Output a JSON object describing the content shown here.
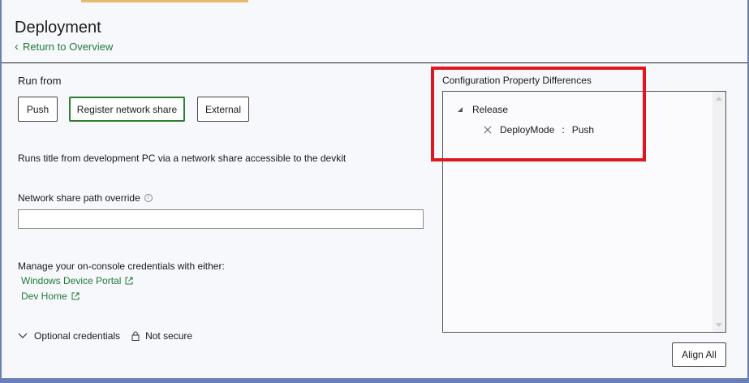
{
  "header": {
    "title": "Deployment",
    "back_link": "Return to Overview"
  },
  "run_from": {
    "label": "Run from",
    "options": [
      {
        "label": "Push"
      },
      {
        "label": "Register network share",
        "selected": true
      },
      {
        "label": "External"
      }
    ],
    "description": "Runs title from development PC via a network share accessible to the devkit"
  },
  "network_share": {
    "label": "Network share path override",
    "info_icon": "info-icon",
    "value": ""
  },
  "credentials": {
    "text": "Manage your on-console credentials with either:",
    "links": [
      {
        "label": "Windows Device Portal",
        "icon": "external-link-icon"
      },
      {
        "label": "Dev Home",
        "icon": "external-link-icon"
      }
    ]
  },
  "optional": {
    "label": "Optional credentials",
    "security_label": "Not secure",
    "icon": "lock-icon"
  },
  "config_diff": {
    "title": "Configuration Property Differences",
    "group": "Release",
    "item": {
      "key": "DeployMode",
      "separator": ":",
      "value": "Push"
    }
  },
  "actions": {
    "align_all": "Align All"
  },
  "colors": {
    "link_green": "#1f7a37",
    "selected_border": "#2e7d32",
    "highlight_red": "#e0161e",
    "frame_blue": "#6a7fb5"
  }
}
